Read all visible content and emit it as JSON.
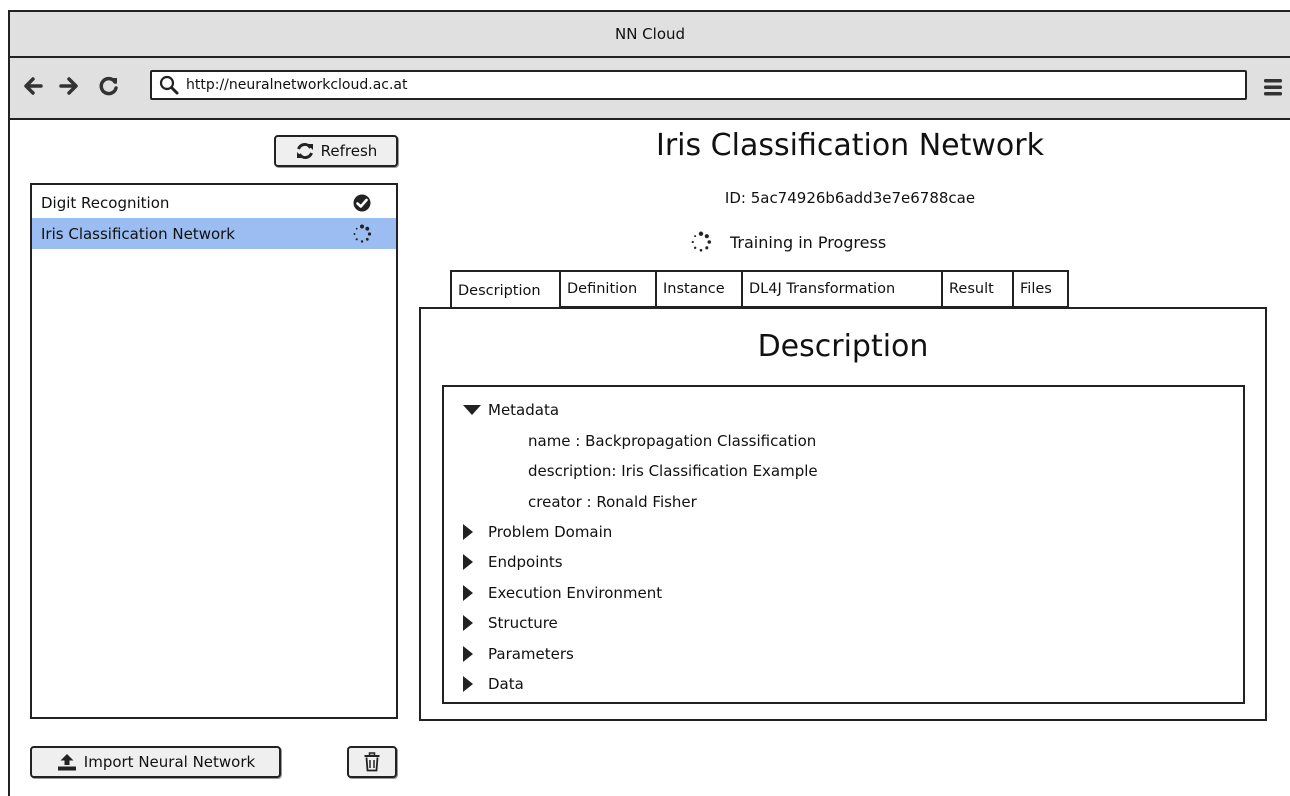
{
  "window": {
    "title": "NN Cloud"
  },
  "browser": {
    "url": "http://neuralnetworkcloud.ac.at",
    "nav_icons": [
      "back-arrow-icon",
      "forward-arrow-icon",
      "reload-icon",
      "search-icon",
      "hamburger-menu-icon"
    ]
  },
  "sidebar": {
    "refresh_label": "Refresh",
    "networks": [
      {
        "name": "Digit Recognition",
        "status_icon": "check-circle-icon",
        "selected": false
      },
      {
        "name": "Iris Classification Network",
        "status_icon": "spinner-icon",
        "selected": true
      }
    ],
    "import_label": "Import Neural Network",
    "delete_icon": "trash-icon"
  },
  "detail": {
    "title": "Iris Classification Network",
    "id_text": "ID: 5ac74926b6add3e7e6788cae",
    "status_text": "Training in Progress",
    "tabs": [
      "Description",
      "Definition",
      "Instance",
      "DL4J Transformation",
      "Result",
      "Files"
    ],
    "active_tab": "Description",
    "panel_title": "Description",
    "tree": {
      "metadata_label": "Metadata",
      "metadata_fields": [
        "name : Backpropagation Classification",
        "description: Iris Classification Example",
        "creator : Ronald Fisher"
      ],
      "collapsed_sections": [
        "Problem Domain",
        "Endpoints",
        "Execution Environment",
        "Structure",
        "Parameters",
        "Data"
      ]
    }
  },
  "colors": {
    "chrome_gray": "#e0e0e0",
    "selection_blue": "#9bbdf2",
    "border": "#222222"
  }
}
